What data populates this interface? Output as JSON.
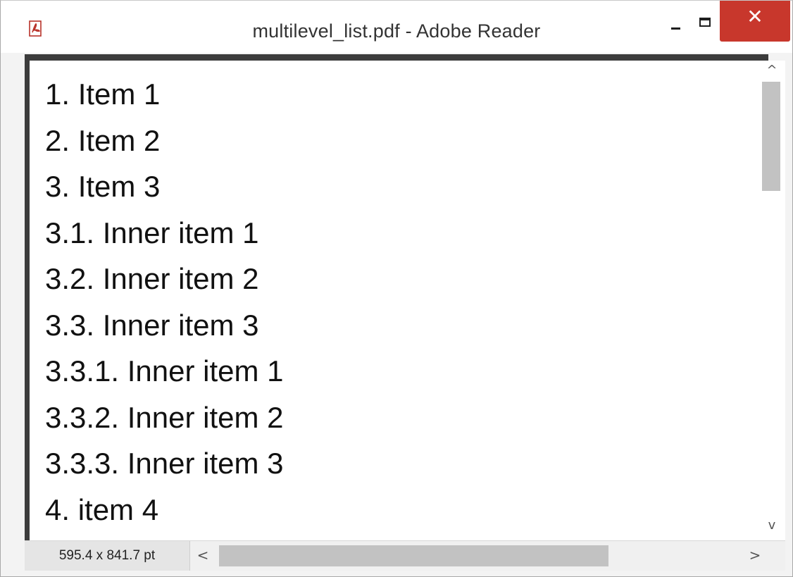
{
  "window": {
    "title": "multilevel_list.pdf - Adobe Reader",
    "icon": "pdf-icon",
    "controls": {
      "minimize": "minimize-icon",
      "maximize": "maximize-icon",
      "close": "close-icon",
      "close_glyph": "✕",
      "close_color": "#c8372c"
    }
  },
  "document": {
    "lines": [
      "1. Item 1",
      "2. Item 2",
      "3. Item 3",
      "3.1. Inner item 1",
      "3.2. Inner item 2",
      "3.3. Inner item 3",
      "3.3.1. Inner item 1",
      "3.3.2. Inner item 2",
      "3.3.3. Inner item 3",
      "4. item 4"
    ]
  },
  "scrollbars": {
    "up_glyph": "^",
    "down_glyph": "v",
    "left_glyph": "<",
    "right_glyph": ">"
  },
  "status": {
    "page_size": "595.4 x 841.7 pt"
  }
}
